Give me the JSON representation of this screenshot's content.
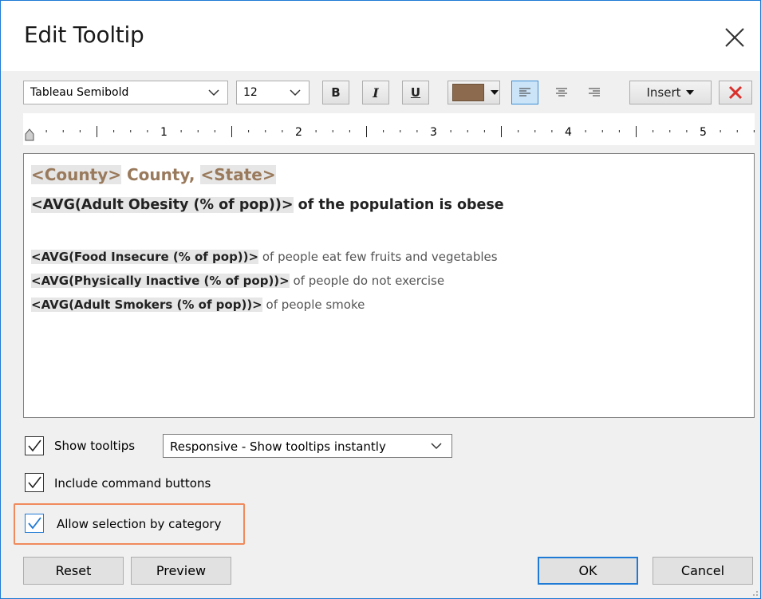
{
  "dialog": {
    "title": "Edit Tooltip"
  },
  "toolbar": {
    "font_family": "Tableau Semibold",
    "font_size": "12",
    "bold_label": "B",
    "italic_label": "I",
    "underline_label": "U",
    "font_color": "#8b6a4e",
    "insert_label": "Insert"
  },
  "ruler": {
    "labels": [
      "1",
      "2",
      "3",
      "4",
      "5"
    ]
  },
  "editor": {
    "line1": {
      "county_field": "<County>",
      "county_text": " County, ",
      "state_field": "<State>"
    },
    "line2": {
      "field": "<AVG(Adult Obesity (% of pop))>",
      "text": " of the population is obese"
    },
    "line3": {
      "field": "<AVG(Food Insecure (% of pop))>",
      "text": " of people eat few fruits and vegetables"
    },
    "line4": {
      "field": "<AVG(Physically Inactive (% of pop))>",
      "text": " of people do not exercise"
    },
    "line5": {
      "field": "<AVG(Adult Smokers (% of pop))>",
      "text": " of people smoke"
    }
  },
  "options": {
    "show_tooltips": {
      "label": "Show tooltips",
      "checked": true
    },
    "tooltip_mode": "Responsive - Show tooltips instantly",
    "include_command_buttons": {
      "label": "Include command buttons",
      "checked": true
    },
    "allow_selection": {
      "label": "Allow selection by category",
      "checked": true
    }
  },
  "buttons": {
    "reset": "Reset",
    "preview": "Preview",
    "ok": "OK",
    "cancel": "Cancel"
  },
  "colors": {
    "accent": "#1f7ad6",
    "highlight": "#f08a5d",
    "field_brown": "#9a7a5c",
    "clear_red": "#d9302c"
  }
}
